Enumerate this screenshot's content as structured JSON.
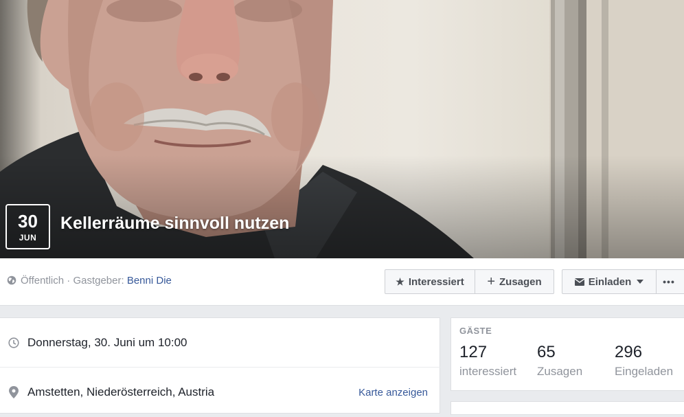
{
  "cover": {
    "date_day": "30",
    "date_month": "JUN",
    "title": "Kellerräume sinnvoll nutzen"
  },
  "meta": {
    "privacy": "Öffentlich",
    "separator": " · ",
    "host_prefix": "Gastgeber: ",
    "host_name": "Benni Die"
  },
  "actions": {
    "interested_label": "Interessiert",
    "going_label": "Zusagen",
    "invite_label": "Einladen",
    "more_label": "•••"
  },
  "details": {
    "datetime": "Donnerstag, 30. Juni um 10:00",
    "location": "Amstetten, Niederösterreich, Austria",
    "map_link": "Karte anzeigen"
  },
  "guests": {
    "title": "GÄSTE",
    "interested_count": "127",
    "interested_label": "interessiert",
    "going_count": "65",
    "going_label": "Zusagen",
    "invited_count": "296",
    "invited_label": "Eingeladen"
  },
  "icons": {
    "privacy": "globe-icon",
    "interested": "star-icon",
    "going": "plus-icon",
    "invite": "envelope-icon",
    "invite_caret": "caret-down-icon",
    "datetime": "clock-icon",
    "location": "map-pin-icon"
  },
  "colors": {
    "link": "#365899",
    "muted_text": "#90949c",
    "page_background": "#e9ebee"
  }
}
